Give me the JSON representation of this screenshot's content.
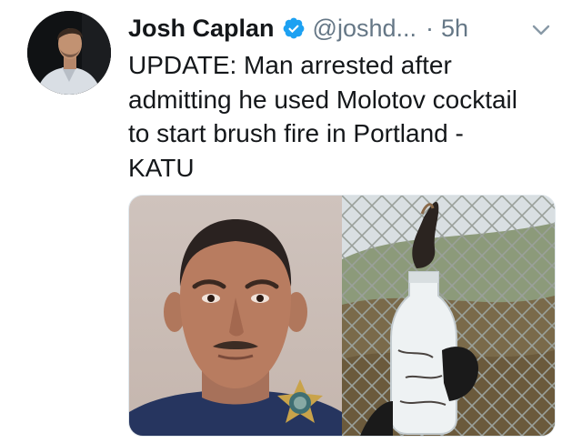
{
  "tweet": {
    "author": {
      "display_name": "Josh Caplan",
      "verified": true,
      "handle": "@joshd...",
      "avatar_icon": "profile-photo"
    },
    "separator": "·",
    "time": "5h",
    "menu_icon": "chevron-down-icon",
    "text_lines": [
      "UPDATE: Man arrested after",
      "admitting he used Molotov cocktail",
      "to start brush fire in Portland -",
      "KATU"
    ],
    "media": [
      {
        "kind": "mugshot-photo"
      },
      {
        "kind": "bottle-at-fence-photo"
      }
    ],
    "colors": {
      "text": "#14171a",
      "secondary": "#657786",
      "verified_badge": "#1da1f2",
      "media_border": "#e1e8ed"
    }
  }
}
